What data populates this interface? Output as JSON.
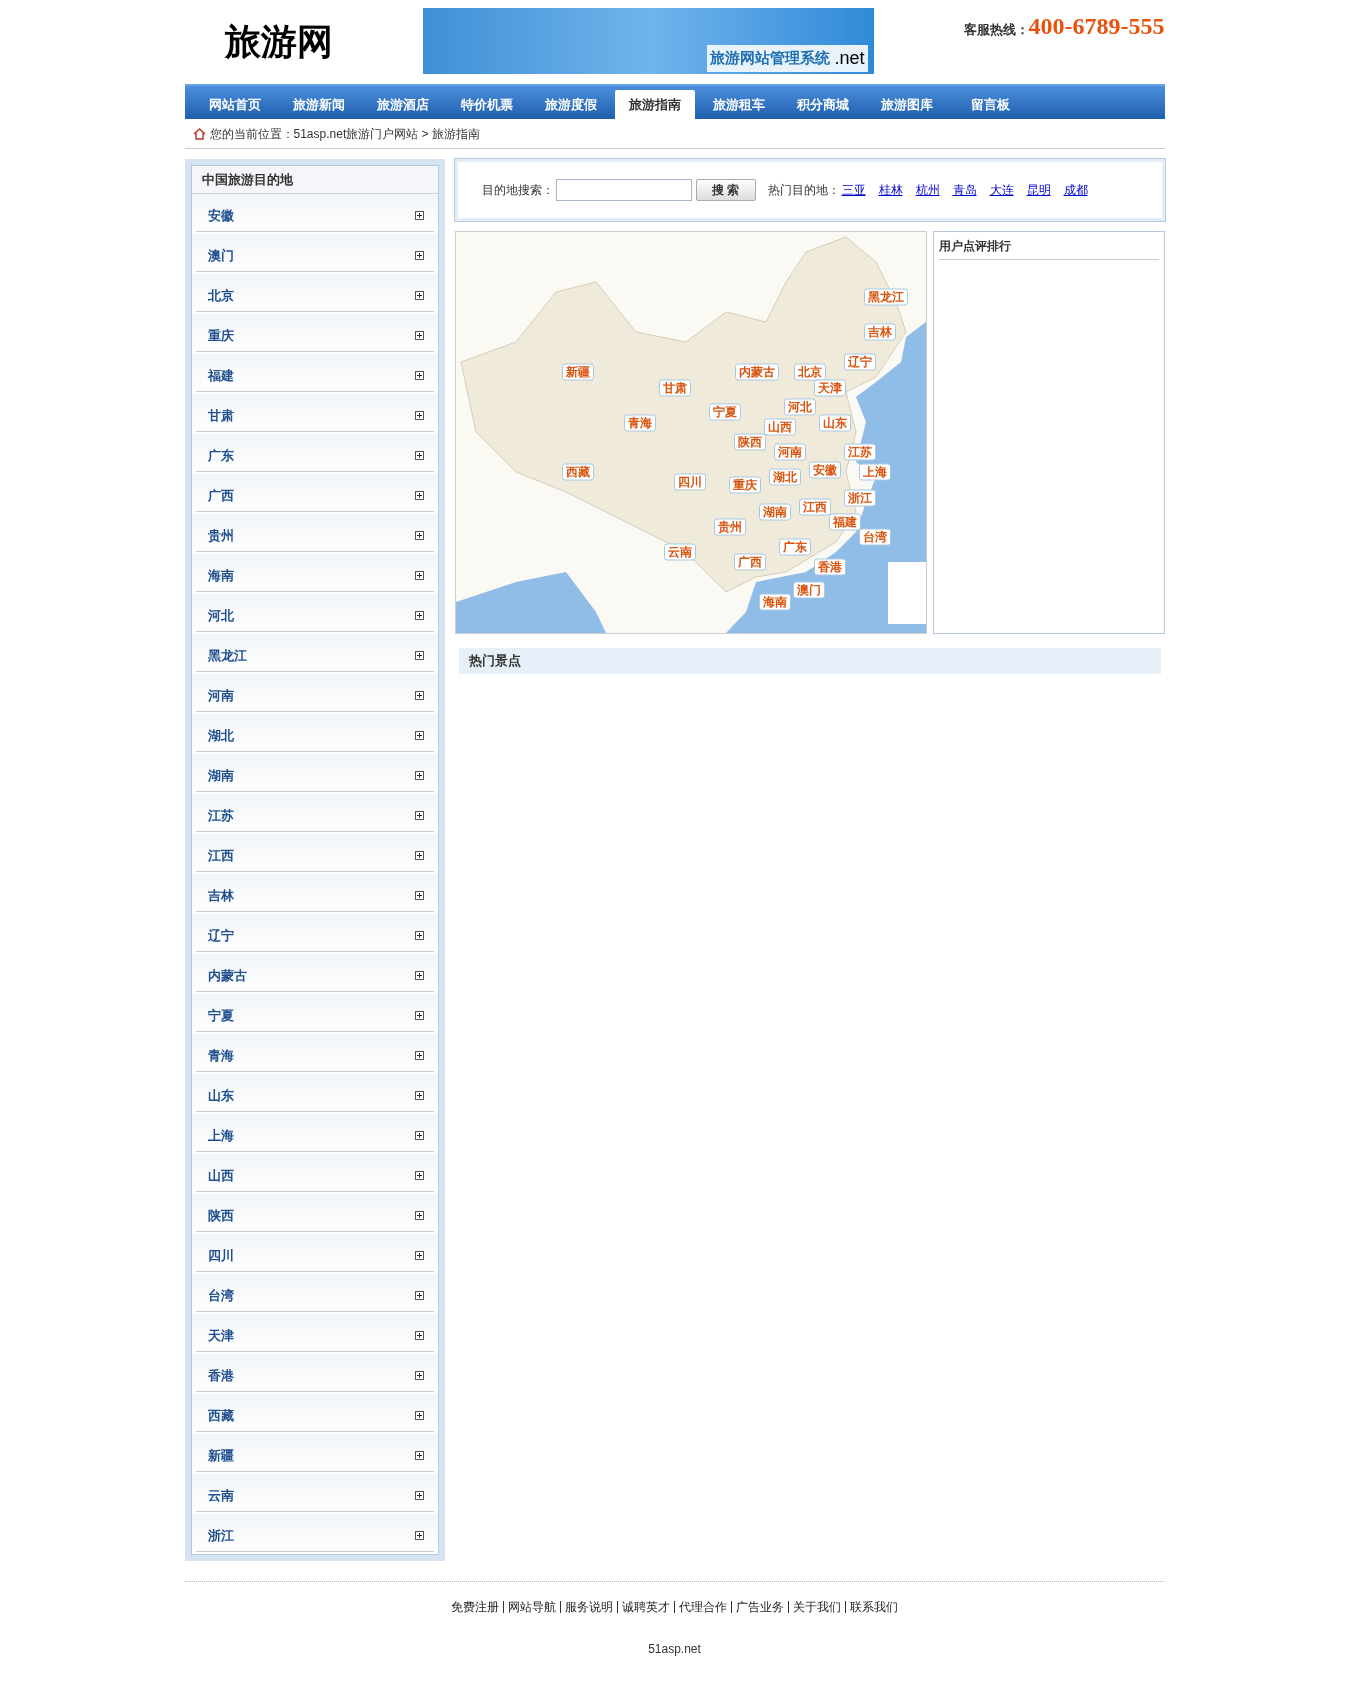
{
  "header": {
    "logo": "旅游网",
    "banner": {
      "title": "旅游网站管理系统",
      "suffix": ".net"
    },
    "hotline_label": "客服热线：",
    "hotline": "400-6789-555"
  },
  "nav": [
    {
      "label": "网站首页",
      "selected": false
    },
    {
      "label": "旅游新闻",
      "selected": false
    },
    {
      "label": "旅游酒店",
      "selected": false
    },
    {
      "label": "特价机票",
      "selected": false
    },
    {
      "label": "旅游度假",
      "selected": false
    },
    {
      "label": "旅游指南",
      "selected": true
    },
    {
      "label": "旅游租车",
      "selected": false
    },
    {
      "label": "积分商城",
      "selected": false
    },
    {
      "label": "旅游图库",
      "selected": false
    },
    {
      "label": "留言板",
      "selected": false
    }
  ],
  "breadcrumb": "您的当前位置：51asp.net旅游门户网站 > 旅游指南",
  "sidebar": {
    "title": "中国旅游目的地",
    "items": [
      "安徽",
      "澳门",
      "北京",
      "重庆",
      "福建",
      "甘肃",
      "广东",
      "广西",
      "贵州",
      "海南",
      "河北",
      "黑龙江",
      "河南",
      "湖北",
      "湖南",
      "江苏",
      "江西",
      "吉林",
      "辽宁",
      "内蒙古",
      "宁夏",
      "青海",
      "山东",
      "上海",
      "山西",
      "陕西",
      "四川",
      "台湾",
      "天津",
      "香港",
      "西藏",
      "新疆",
      "云南",
      "浙江"
    ]
  },
  "search": {
    "label": "目的地搜索：",
    "button": "搜 索",
    "hot_label": "热门目的地：",
    "hot": [
      "三亚",
      "桂林",
      "杭州",
      "青岛",
      "大连",
      "昆明",
      "成都"
    ]
  },
  "map_labels": [
    "黑龙江",
    "吉林",
    "辽宁",
    "新疆",
    "内蒙古",
    "北京",
    "甘肃",
    "天津",
    "宁夏",
    "河北",
    "青海",
    "山西",
    "山东",
    "陕西",
    "河南",
    "江苏",
    "西藏",
    "四川",
    "重庆",
    "湖北",
    "安徽",
    "上海",
    "浙江",
    "湖南",
    "江西",
    "贵州",
    "福建",
    "台湾",
    "云南",
    "广东",
    "广西",
    "香港",
    "澳门",
    "海南"
  ],
  "ranking": {
    "title": "用户点评排行"
  },
  "hot_spots": {
    "title": "热门景点"
  },
  "footer": {
    "links": [
      "免费注册",
      "网站导航",
      "服务说明",
      "诚聘英才",
      "代理合作",
      "广告业务",
      "关于我们",
      "联系我们"
    ],
    "copyright": "51asp.net"
  }
}
